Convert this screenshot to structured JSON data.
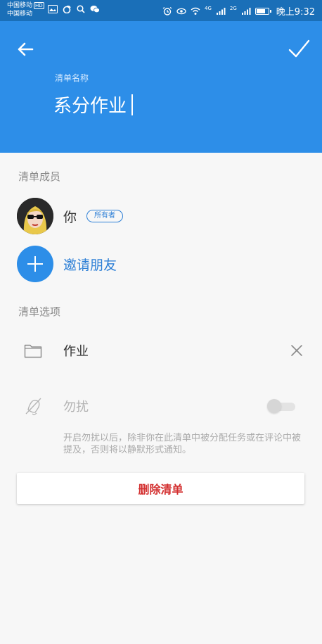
{
  "status_bar": {
    "carrier1": "中国移动",
    "carrier2": "中国移动",
    "hd": "HD",
    "signal1": "4G",
    "signal2": "2G",
    "time": "晚上9:32"
  },
  "header": {
    "name_label": "清单名称",
    "name_value": "系分作业",
    "back_icon": "arrow-left-icon",
    "confirm_icon": "check-icon"
  },
  "members": {
    "title": "清单成员",
    "owner_name": "你",
    "owner_badge": "所有者",
    "invite_label": "邀请朋友"
  },
  "options": {
    "title": "清单选项",
    "folder_label": "作业",
    "dnd_label": "勿扰",
    "dnd_enabled": false,
    "dnd_description": "开启勿扰以后，除非你在此清单中被分配任务或在评论中被提及，否则将以静默形式通知。",
    "delete_label": "删除清单"
  },
  "colors": {
    "header": "#2d8ee8",
    "status_bar": "#1a6fb8",
    "accent": "#2d7fd6",
    "danger": "#d32f2f"
  }
}
